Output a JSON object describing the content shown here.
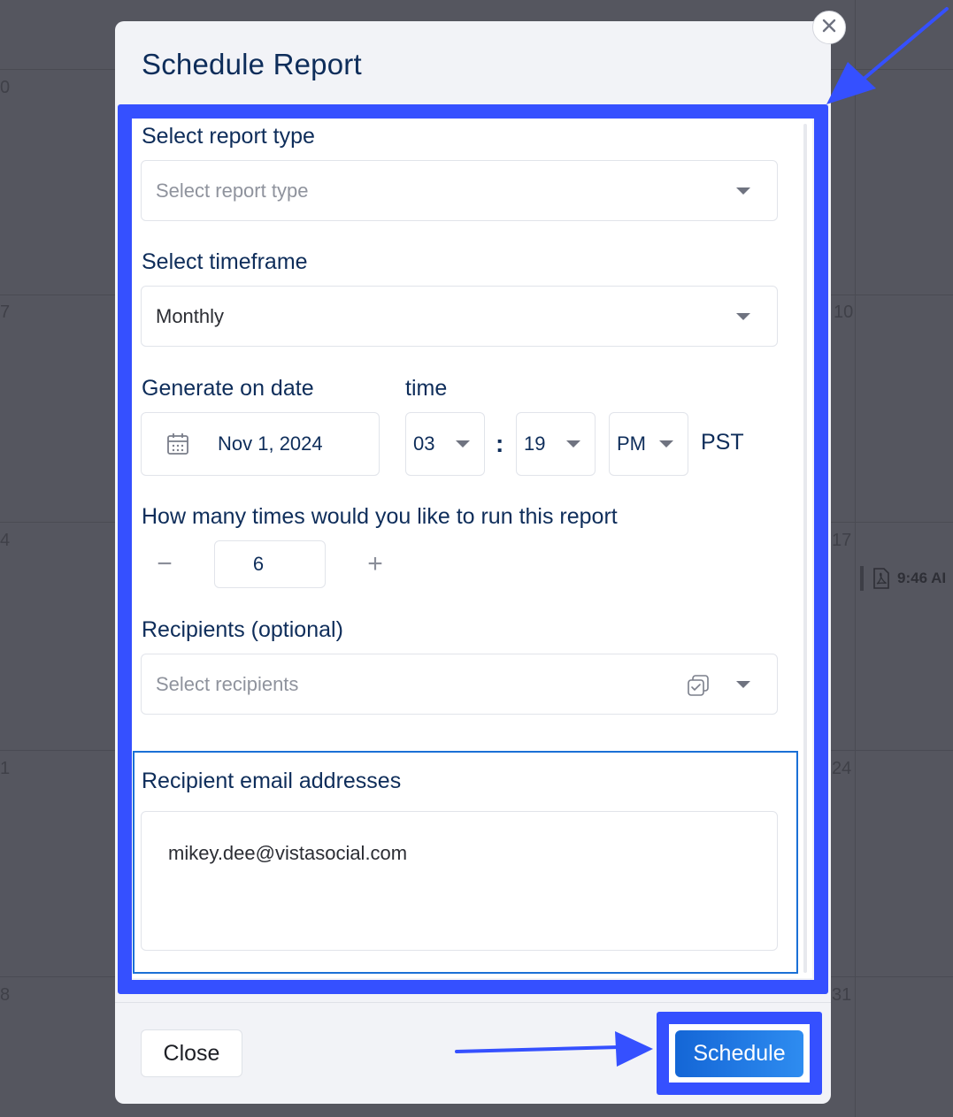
{
  "background_calendar": {
    "day_numbers": [
      "0",
      "7",
      "10",
      "4",
      "17",
      "1",
      "24",
      "8",
      "31"
    ],
    "event_time": "9:46 AI"
  },
  "modal": {
    "title": "Schedule Report",
    "report_type": {
      "label": "Select report type",
      "placeholder": "Select report type"
    },
    "timeframe": {
      "label": "Select timeframe",
      "value": "Monthly"
    },
    "generate_date": {
      "label": "Generate on date",
      "value": "Nov 1, 2024"
    },
    "time": {
      "label": "time",
      "hour": "03",
      "separator": ":",
      "minute": "19",
      "meridiem": "PM",
      "timezone": "PST"
    },
    "run_count": {
      "label": "How many times would you like to run this report",
      "value": "6",
      "decrement": "−",
      "increment": "+"
    },
    "recipients": {
      "label": "Recipients (optional)",
      "placeholder": "Select recipients"
    },
    "emails": {
      "label": "Recipient email addresses",
      "value": "mikey.dee@vistasocial.com"
    },
    "footer": {
      "close_label": "Close",
      "schedule_label": "Schedule"
    }
  },
  "colors": {
    "accent": "#3550ff",
    "primary_button": "#1a73e0",
    "title_text": "#0e2d5a",
    "overlay": "#55565f"
  }
}
